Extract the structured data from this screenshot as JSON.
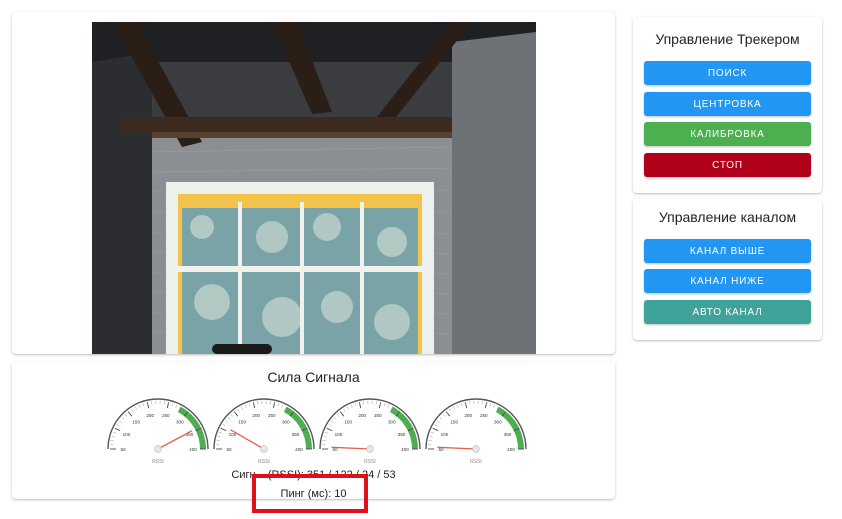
{
  "tracker_panel": {
    "title": "Управление Трекером",
    "buttons": [
      {
        "label": "Поиск",
        "color": "#2196f3"
      },
      {
        "label": "Центровка",
        "color": "#2196f3"
      },
      {
        "label": "Калибровка",
        "color": "#4caf50"
      },
      {
        "label": "Стоп",
        "color": "#b0001a"
      }
    ]
  },
  "channel_panel": {
    "title": "Управление каналом",
    "buttons": [
      {
        "label": "Канал выше",
        "color": "#2196f3"
      },
      {
        "label": "Канал ниже",
        "color": "#2196f3"
      },
      {
        "label": "Авто канал",
        "color": "#3fa39a"
      }
    ]
  },
  "signal": {
    "title": "Сила Сигнала",
    "gauge_unit": "RSSI",
    "gauge_ticks": [
      "50",
      "100",
      "150",
      "200",
      "250",
      "300",
      "350",
      "400"
    ],
    "gauge_values": [
      345,
      108,
      55,
      55
    ],
    "gauge_range": [
      50,
      400
    ],
    "signal_line": "Сигн... (RSSI): 351 / 122 / 24 / 53",
    "ping_line": "Пинг (мс): 10"
  },
  "colors": {
    "gauge_green": "#4caf50",
    "needle": "#e8604c",
    "highlight": "#e0101a"
  }
}
